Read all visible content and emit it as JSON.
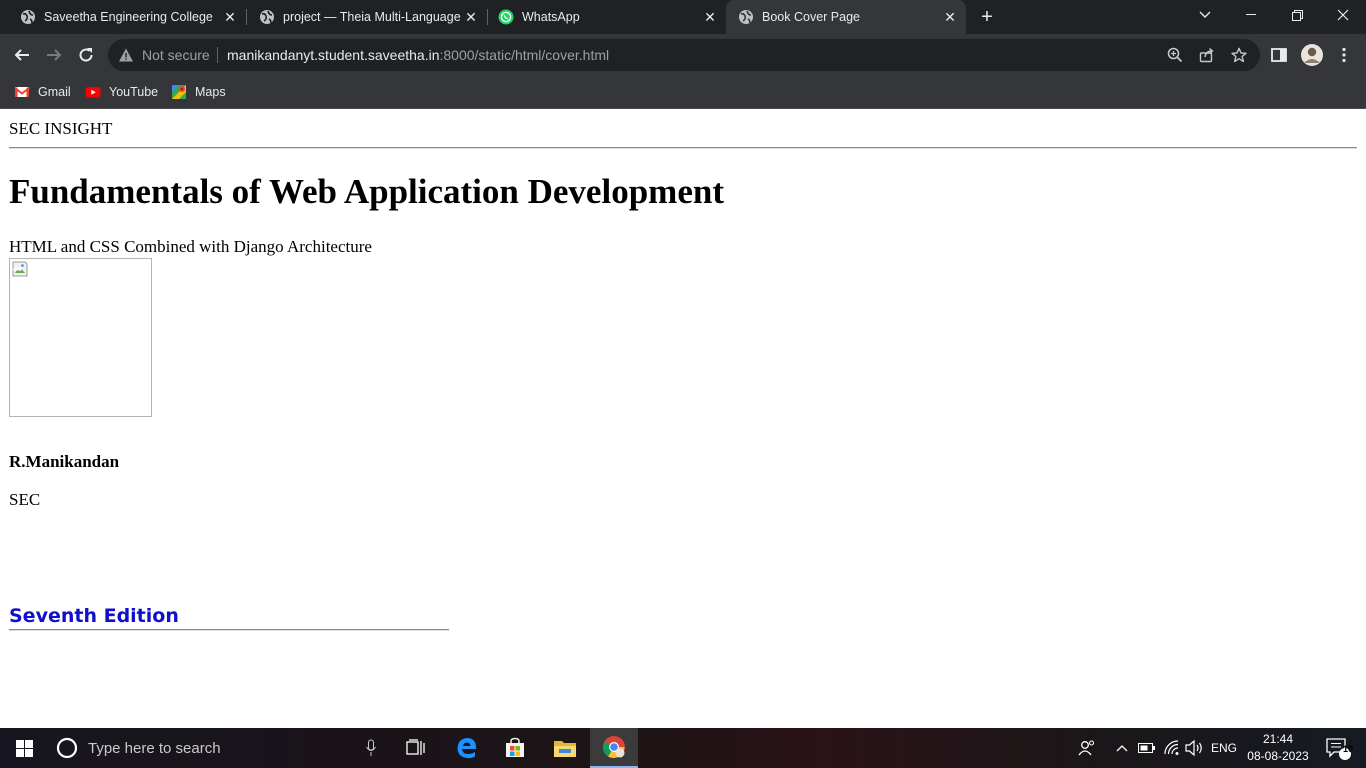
{
  "browser": {
    "tabs": [
      {
        "title": "Saveetha Engineering College",
        "favicon": "globe-icon",
        "active": false
      },
      {
        "title": "project — Theia Multi-Language",
        "favicon": "globe-icon",
        "active": false
      },
      {
        "title": "WhatsApp",
        "favicon": "whatsapp-icon",
        "active": false
      },
      {
        "title": "Book Cover Page",
        "favicon": "globe-icon",
        "active": true
      }
    ],
    "address_bar": {
      "security_label": "Not secure",
      "url_host": "manikandanyt.student.saveetha.in",
      "url_rest": ":8000/static/html/cover.html"
    },
    "bookmarks": [
      {
        "label": "Gmail",
        "icon": "gmail-icon"
      },
      {
        "label": "YouTube",
        "icon": "youtube-icon"
      },
      {
        "label": "Maps",
        "icon": "maps-icon"
      }
    ]
  },
  "page": {
    "brand": "SEC INSIGHT",
    "title": "Fundamentals of Web Application Development",
    "subtitle": "HTML and CSS Combined with Django Architecture",
    "author": "R.Manikandan",
    "institution": "SEC",
    "edition": "Seventh Edition",
    "edition_color": "#1010cc"
  },
  "taskbar": {
    "search_placeholder": "Type here to search",
    "language": "ENG",
    "time": "21:44",
    "date": "08-08-2023",
    "notification_count": "10"
  }
}
